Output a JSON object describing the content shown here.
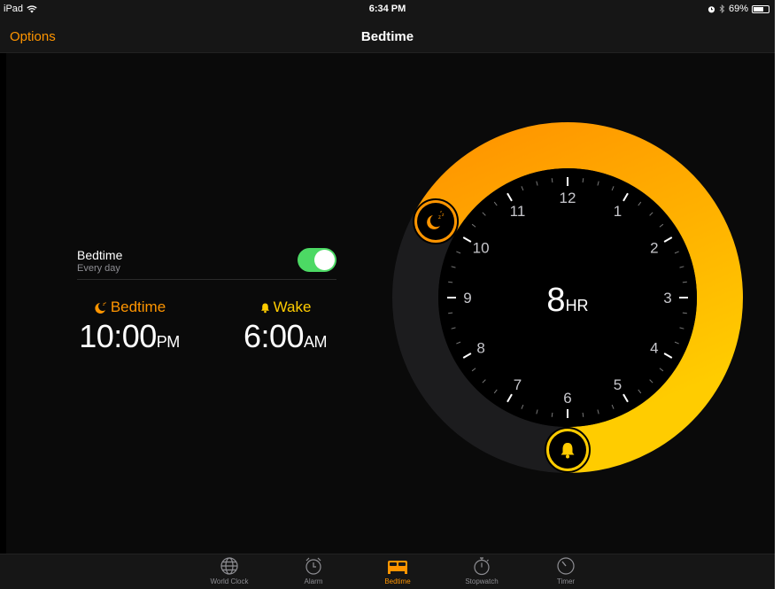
{
  "status_bar": {
    "device": "iPad",
    "time": "6:34 PM",
    "battery": "69%",
    "battery_level": 0.69
  },
  "nav": {
    "options_label": "Options",
    "title": "Bedtime"
  },
  "schedule": {
    "label": "Bedtime",
    "repeat": "Every day",
    "enabled": true
  },
  "bedtime": {
    "label": "Bedtime",
    "time": "10:00",
    "ampm": "PM",
    "icon": "moon-zzz-icon"
  },
  "wake": {
    "label": "Wake",
    "time": "6:00",
    "ampm": "AM",
    "icon": "bell-icon"
  },
  "clock": {
    "numbers": [
      "12",
      "1",
      "2",
      "3",
      "4",
      "5",
      "6",
      "7",
      "8",
      "9",
      "10",
      "11"
    ],
    "duration": "8",
    "duration_unit": "HR",
    "bedtime_hour": 22,
    "wake_hour": 6
  },
  "colors": {
    "accent": "#ff9500",
    "wake": "#ffcc00",
    "toggle_on": "#4cd964",
    "background": "#0a0a0a",
    "track": "#1c1c1e"
  },
  "tabs": [
    {
      "label": "World Clock",
      "icon": "globe-icon",
      "active": false
    },
    {
      "label": "Alarm",
      "icon": "alarm-clock-icon",
      "active": false
    },
    {
      "label": "Bedtime",
      "icon": "bed-icon",
      "active": true
    },
    {
      "label": "Stopwatch",
      "icon": "stopwatch-icon",
      "active": false
    },
    {
      "label": "Timer",
      "icon": "timer-icon",
      "active": false
    }
  ]
}
